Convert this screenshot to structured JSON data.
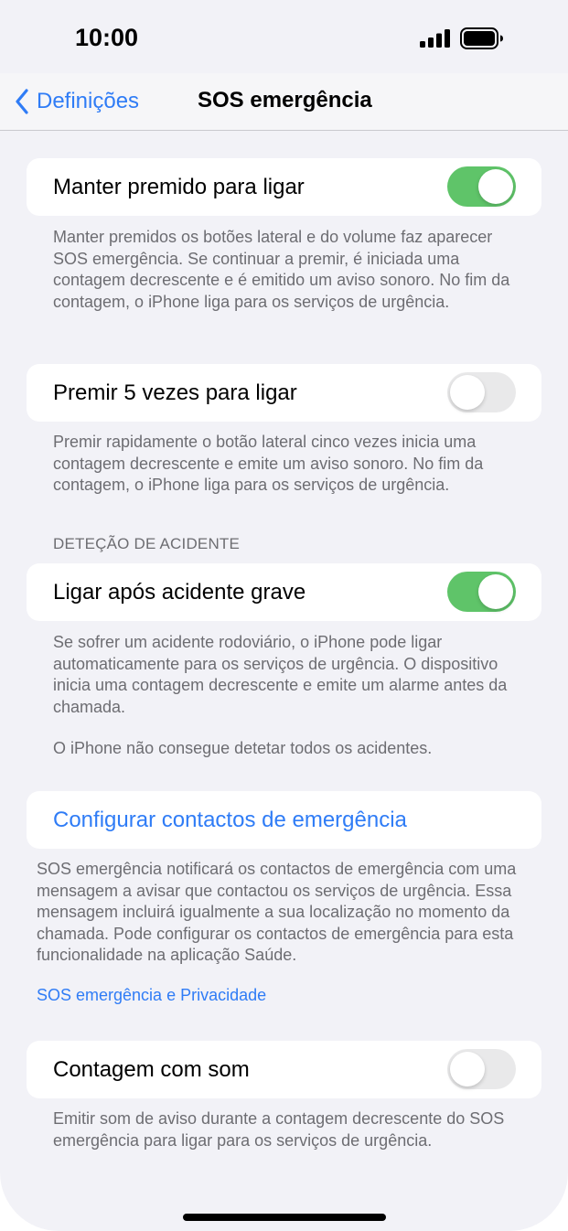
{
  "status_bar": {
    "time": "10:00"
  },
  "navbar": {
    "back_label": "Definições",
    "title": "SOS emergência"
  },
  "hold_to_call": {
    "label": "Manter premido para ligar",
    "enabled": true,
    "footer": "Manter premidos os botões lateral e do volume faz aparecer SOS emergência. Se continuar a premir, é iniciada uma contagem decrescente e é emitido um aviso sonoro. No fim da contagem, o iPhone liga para os serviços de urgência."
  },
  "press_5_times": {
    "label": "Premir 5 vezes para ligar",
    "enabled": false,
    "footer": "Premir rapidamente o botão lateral cinco vezes inicia uma contagem decrescente e emite um aviso sonoro. No fim da contagem, o iPhone liga para os serviços de urgência."
  },
  "crash_detection": {
    "header": "DETEÇÃO DE ACIDENTE",
    "label": "Ligar após acidente grave",
    "enabled": true,
    "footer": "Se sofrer um acidente rodoviário, o iPhone pode ligar automaticamente para os serviços de urgência. O dispositivo inicia uma contagem decrescente e emite um alarme antes da chamada.",
    "note": "O iPhone não consegue detetar todos os acidentes."
  },
  "emergency_contacts": {
    "label": "Configurar contactos de emergência",
    "footer": "SOS emergência notificará os contactos de emergência com uma mensagem a avisar que contactou os serviços de urgência. Essa mensagem incluirá igualmente a sua localização no momento da chamada. Pode configurar os contactos de emergência para esta funcionalidade na aplicação Saúde.",
    "privacy_link": "SOS emergência e Privacidade"
  },
  "countdown_sound": {
    "label": "Contagem com som",
    "enabled": false,
    "footer": "Emitir som de aviso durante a contagem decrescente do SOS emergência para ligar para os serviços de urgência."
  },
  "colors": {
    "accent": "#2f7cf6",
    "toggle_on": "#5fc469",
    "background": "#f2f2f7"
  }
}
